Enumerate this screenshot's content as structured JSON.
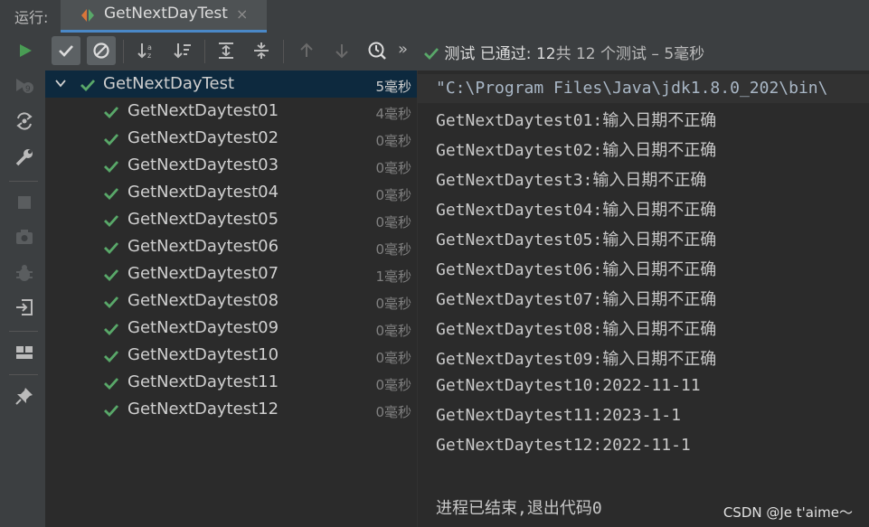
{
  "header": {
    "run_label": "运行:",
    "tab_title": "GetNextDayTest",
    "tab_close": "×"
  },
  "toolbar": {
    "more_label": "»",
    "status_prefix": "测试 已通过: 12",
    "status_suffix": "共 12 个测试 – 5毫秒"
  },
  "tree": {
    "root": {
      "name": "GetNextDayTest",
      "time": "5毫秒"
    },
    "items": [
      {
        "name": "GetNextDaytest01",
        "time": "4毫秒"
      },
      {
        "name": "GetNextDaytest02",
        "time": "0毫秒"
      },
      {
        "name": "GetNextDaytest03",
        "time": "0毫秒"
      },
      {
        "name": "GetNextDaytest04",
        "time": "0毫秒"
      },
      {
        "name": "GetNextDaytest05",
        "time": "0毫秒"
      },
      {
        "name": "GetNextDaytest06",
        "time": "0毫秒"
      },
      {
        "name": "GetNextDaytest07",
        "time": "1毫秒"
      },
      {
        "name": "GetNextDaytest08",
        "time": "0毫秒"
      },
      {
        "name": "GetNextDaytest09",
        "time": "0毫秒"
      },
      {
        "name": "GetNextDaytest10",
        "time": "0毫秒"
      },
      {
        "name": "GetNextDaytest11",
        "time": "0毫秒"
      },
      {
        "name": "GetNextDaytest12",
        "time": "0毫秒"
      }
    ]
  },
  "console": {
    "command": "\"C:\\Program Files\\Java\\jdk1.8.0_202\\bin\\",
    "lines": [
      "GetNextDaytest01:输入日期不正确",
      "GetNextDaytest02:输入日期不正确",
      "GetNextDaytest3:输入日期不正确",
      "GetNextDaytest04:输入日期不正确",
      "GetNextDaytest05:输入日期不正确",
      "GetNextDaytest06:输入日期不正确",
      "GetNextDaytest07:输入日期不正确",
      "GetNextDaytest08:输入日期不正确",
      "GetNextDaytest09:输入日期不正确",
      "GetNextDaytest10:2022-11-11",
      "GetNextDaytest11:2023-1-1",
      "GetNextDaytest12:2022-11-1"
    ],
    "exit_message": "进程已结束,退出代码0"
  },
  "watermark": "CSDN @Je t'aime～",
  "colors": {
    "pass_green": "#59a869",
    "run_green": "#499c54",
    "selection": "#0d293e",
    "accent_blue": "#4a88c7"
  }
}
